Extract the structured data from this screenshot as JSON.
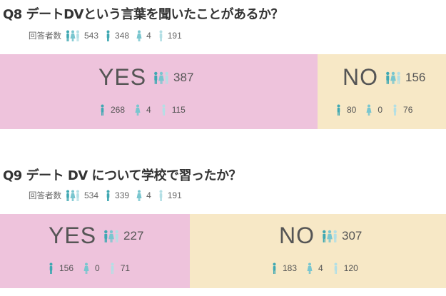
{
  "colors": {
    "yes_bg": "#eec3dc",
    "no_bg": "#f7e8c6",
    "male_icon": "#3fa8b2",
    "female_icon": "#79c6cf",
    "other_icon": "#b3dfe5"
  },
  "icons": {
    "all": "people-group-icon",
    "male": "person-male-icon",
    "female": "person-female-icon",
    "other": "person-other-icon"
  },
  "q8": {
    "title": "Q8 デートDVという言葉を聞いたことがあるか？",
    "respondents_label": "回答者数",
    "respondents": {
      "total": "543",
      "male": "348",
      "female": "4",
      "other": "191"
    },
    "yes": {
      "label": "YES",
      "total": "387",
      "male": "268",
      "female": "4",
      "other": "115"
    },
    "no": {
      "label": "NO",
      "total": "156",
      "male": "80",
      "female": "0",
      "other": "76"
    }
  },
  "q9": {
    "title": "Q9 デート DV について学校で習ったか？",
    "respondents_label": "回答者数",
    "respondents": {
      "total": "534",
      "male": "339",
      "female": "4",
      "other": "191"
    },
    "yes": {
      "label": "YES",
      "total": "227",
      "male": "156",
      "female": "0",
      "other": "71"
    },
    "no": {
      "label": "NO",
      "total": "307",
      "male": "183",
      "female": "4",
      "other": "120"
    }
  },
  "chart_data": [
    {
      "type": "bar",
      "title": "Q8 デートDVという言葉を聞いたことがあるか？",
      "categories": [
        "YES",
        "NO"
      ],
      "values": [
        387,
        156
      ],
      "respondents": 543,
      "breakdown": [
        {
          "category": "YES",
          "values": [
            268,
            4,
            115
          ]
        },
        {
          "category": "NO",
          "values": [
            80,
            0,
            76
          ]
        }
      ]
    },
    {
      "type": "bar",
      "title": "Q9 デート DV について学校で習ったか？",
      "categories": [
        "YES",
        "NO"
      ],
      "values": [
        227,
        307
      ],
      "respondents": 534,
      "breakdown": [
        {
          "category": "YES",
          "values": [
            156,
            0,
            71
          ]
        },
        {
          "category": "NO",
          "values": [
            183,
            4,
            120
          ]
        }
      ]
    }
  ]
}
